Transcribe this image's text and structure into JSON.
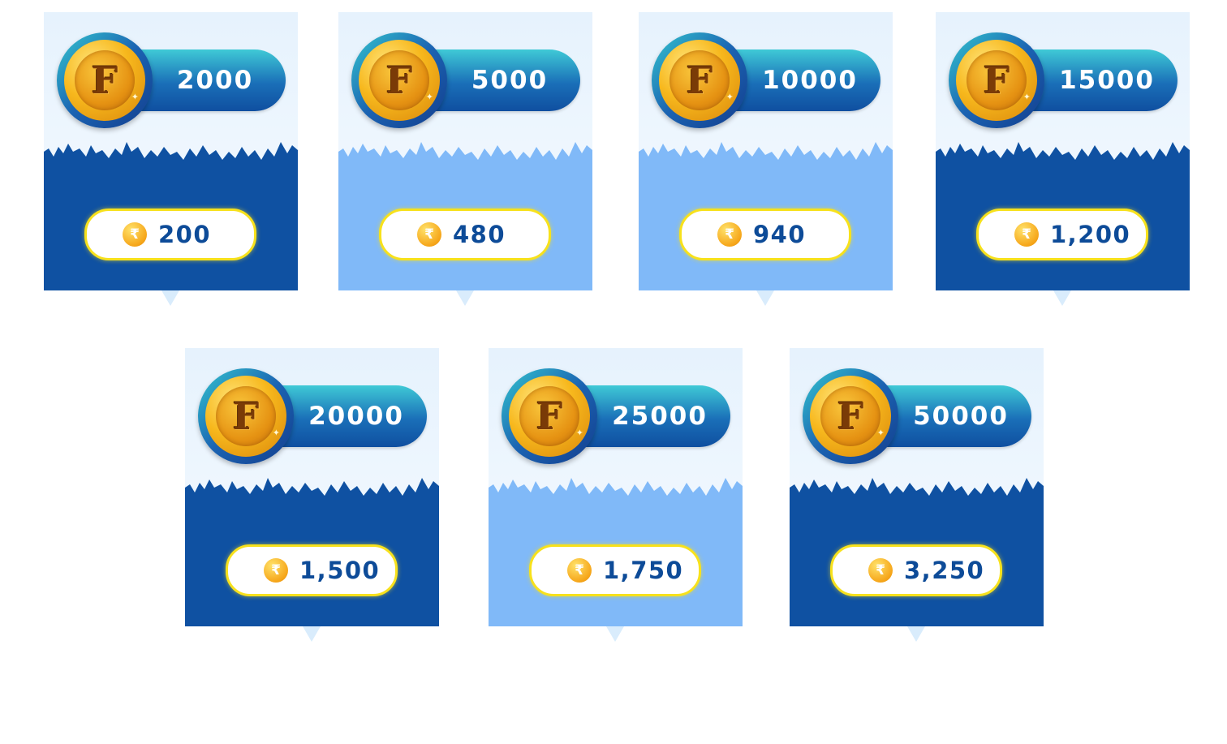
{
  "colors": {
    "dark_blue": "#0f51a2",
    "light_blue": "#80b9f8",
    "pill_gradient_top": "#3fc9d6",
    "price_border": "#f7e11c",
    "price_text": "#0d4b98"
  },
  "icons": {
    "coin": "gold-f-coin-icon",
    "rupee": "rupee-coin-icon"
  },
  "packs": [
    {
      "coin_letter": "F",
      "amount": "2000",
      "rupee_symbol": "₹",
      "price": "200",
      "theme": "dark"
    },
    {
      "coin_letter": "F",
      "amount": "5000",
      "rupee_symbol": "₹",
      "price": "480",
      "theme": "light"
    },
    {
      "coin_letter": "F",
      "amount": "10000",
      "rupee_symbol": "₹",
      "price": "940",
      "theme": "light"
    },
    {
      "coin_letter": "F",
      "amount": "15000",
      "rupee_symbol": "₹",
      "price": "1,200",
      "theme": "dark"
    },
    {
      "coin_letter": "F",
      "amount": "20000",
      "rupee_symbol": "₹",
      "price": "1,500",
      "theme": "dark"
    },
    {
      "coin_letter": "F",
      "amount": "25000",
      "rupee_symbol": "₹",
      "price": "1,750",
      "theme": "light"
    },
    {
      "coin_letter": "F",
      "amount": "50000",
      "rupee_symbol": "₹",
      "price": "3,250",
      "theme": "dark"
    }
  ]
}
